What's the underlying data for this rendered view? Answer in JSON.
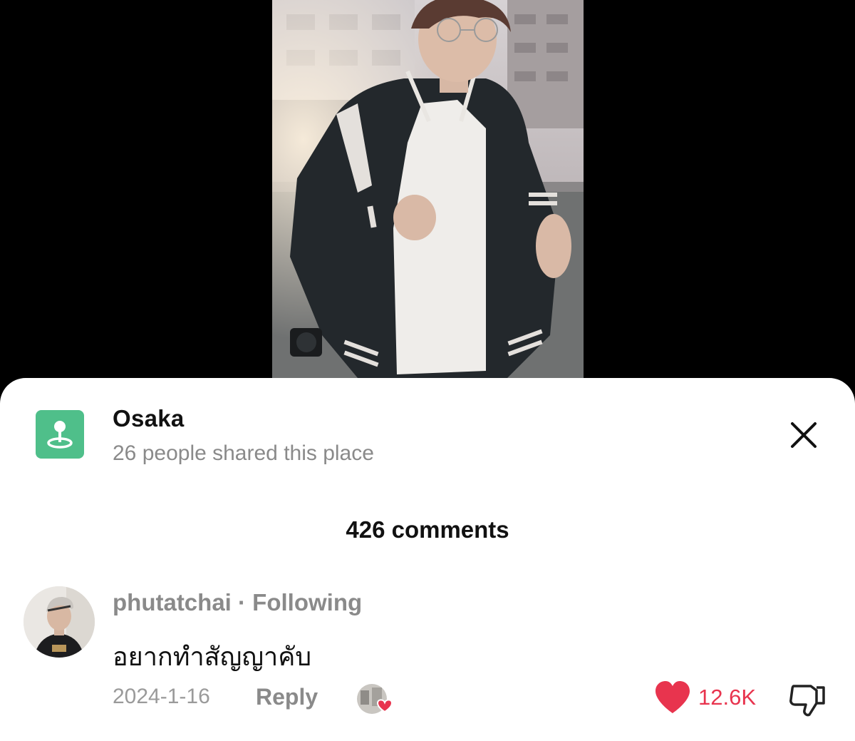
{
  "location": {
    "name": "Osaka",
    "subtitle": "26 people shared this place",
    "accent_color": "#4fbf8a"
  },
  "comments_header": "426 comments",
  "comment": {
    "username": "phutatchai",
    "relationship": "· Following",
    "text": "อยากทำสัญญาคับ",
    "date": "2024-1-16",
    "reply_label": "Reply",
    "like_count": "12.6K",
    "like_color": "#e8344e"
  },
  "icons": {
    "location": "location-pin-icon",
    "close": "close-icon",
    "like": "heart-icon",
    "dislike": "thumbs-down-icon",
    "creator_liked": "creator-liked-icon"
  }
}
